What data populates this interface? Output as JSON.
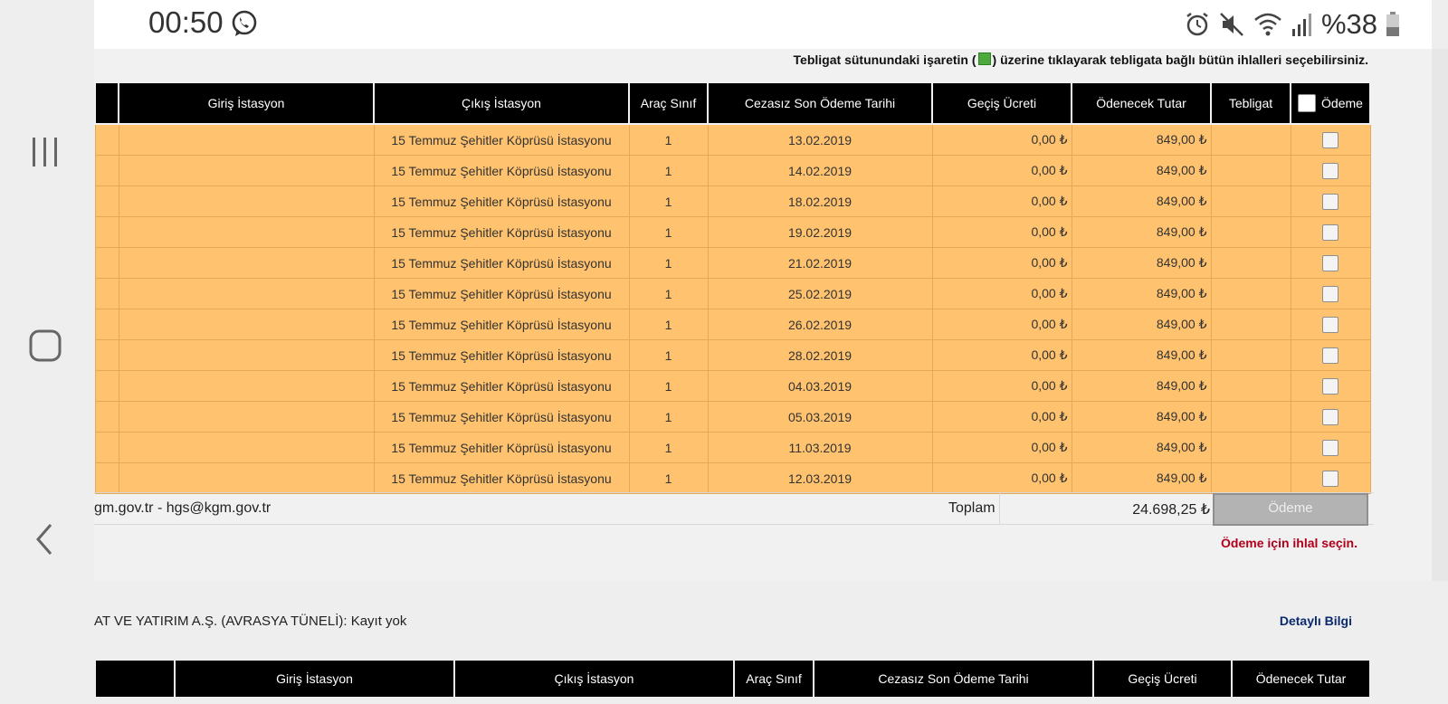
{
  "status_bar": {
    "time": "00:50",
    "battery": "%38",
    "icons": [
      "whatsapp-icon",
      "alarm-icon",
      "mute-icon",
      "wifi-icon",
      "signal-icon",
      "battery-icon"
    ]
  },
  "notice": {
    "before": "Tebligat sütunundaki işaretin (",
    "after": ") üzerine tıklayarak tebligata bağlı bütün ihlalleri seçebilirsiniz."
  },
  "table": {
    "headers": {
      "giris": "Giriş İstasyon",
      "cikis": "Çıkış İstasyon",
      "arac": "Araç Sınıf",
      "tarih": "Cezasız Son Ödeme Tarihi",
      "ucret": "Geçiş Ücreti",
      "tutar": "Ödenecek Tutar",
      "tebligat": "Tebligat",
      "odeme": "Ödeme"
    },
    "rows": [
      {
        "giris": "",
        "cikis": "15 Temmuz Şehitler Köprüsü İstasyonu",
        "arac": "1",
        "tarih": "13.02.2019",
        "ucret": "0,00 ₺",
        "tutar": "849,00 ₺"
      },
      {
        "giris": "",
        "cikis": "15 Temmuz Şehitler Köprüsü İstasyonu",
        "arac": "1",
        "tarih": "14.02.2019",
        "ucret": "0,00 ₺",
        "tutar": "849,00 ₺"
      },
      {
        "giris": "",
        "cikis": "15 Temmuz Şehitler Köprüsü İstasyonu",
        "arac": "1",
        "tarih": "18.02.2019",
        "ucret": "0,00 ₺",
        "tutar": "849,00 ₺"
      },
      {
        "giris": "",
        "cikis": "15 Temmuz Şehitler Köprüsü İstasyonu",
        "arac": "1",
        "tarih": "19.02.2019",
        "ucret": "0,00 ₺",
        "tutar": "849,00 ₺"
      },
      {
        "giris": "",
        "cikis": "15 Temmuz Şehitler Köprüsü İstasyonu",
        "arac": "1",
        "tarih": "21.02.2019",
        "ucret": "0,00 ₺",
        "tutar": "849,00 ₺"
      },
      {
        "giris": "",
        "cikis": "15 Temmuz Şehitler Köprüsü İstasyonu",
        "arac": "1",
        "tarih": "25.02.2019",
        "ucret": "0,00 ₺",
        "tutar": "849,00 ₺"
      },
      {
        "giris": "",
        "cikis": "15 Temmuz Şehitler Köprüsü İstasyonu",
        "arac": "1",
        "tarih": "26.02.2019",
        "ucret": "0,00 ₺",
        "tutar": "849,00 ₺"
      },
      {
        "giris": "",
        "cikis": "15 Temmuz Şehitler Köprüsü İstasyonu",
        "arac": "1",
        "tarih": "28.02.2019",
        "ucret": "0,00 ₺",
        "tutar": "849,00 ₺"
      },
      {
        "giris": "",
        "cikis": "15 Temmuz Şehitler Köprüsü İstasyonu",
        "arac": "1",
        "tarih": "04.03.2019",
        "ucret": "0,00 ₺",
        "tutar": "849,00 ₺"
      },
      {
        "giris": "",
        "cikis": "15 Temmuz Şehitler Köprüsü İstasyonu",
        "arac": "1",
        "tarih": "05.03.2019",
        "ucret": "0,00 ₺",
        "tutar": "849,00 ₺"
      },
      {
        "giris": "",
        "cikis": "15 Temmuz Şehitler Köprüsü İstasyonu",
        "arac": "1",
        "tarih": "11.03.2019",
        "ucret": "0,00 ₺",
        "tutar": "849,00 ₺"
      },
      {
        "giris": "",
        "cikis": "15 Temmuz Şehitler Köprüsü İstasyonu",
        "arac": "1",
        "tarih": "12.03.2019",
        "ucret": "0,00 ₺",
        "tutar": "849,00 ₺"
      }
    ],
    "row_color": "#ffc26e"
  },
  "footer": {
    "email": "gm.gov.tr - hgs@kgm.gov.tr",
    "toplam_label": "Toplam",
    "toplam_value": "24.698,25 ₺",
    "pay_button": "Ödeme"
  },
  "warning": "Ödeme için ihlal seçin.",
  "section2": {
    "title": "AT VE YATIRIM A.Ş. (AVRASYA TÜNELİ): Kayıt yok",
    "link": "Detaylı Bilgi",
    "headers": {
      "giris": "Giriş İstasyon",
      "cikis": "Çıkış İstasyon",
      "arac": "Araç Sınıf",
      "tarih": "Cezasız Son Ödeme Tarihi",
      "ucret": "Geçiş Ücreti",
      "tutar": "Ödenecek Tutar"
    }
  }
}
